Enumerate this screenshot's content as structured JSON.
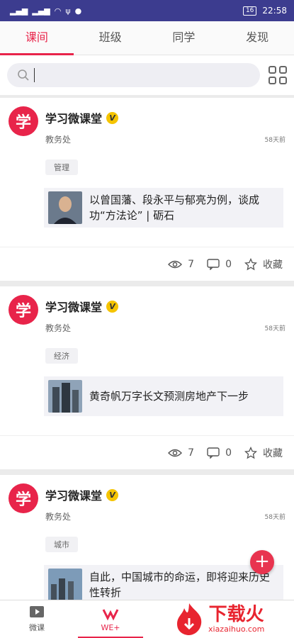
{
  "status_bar": {
    "time": "22:58",
    "battery": "16"
  },
  "tabs": [
    {
      "label": "课间",
      "active": true
    },
    {
      "label": "班级",
      "active": false
    },
    {
      "label": "同学",
      "active": false
    },
    {
      "label": "发现",
      "active": false
    }
  ],
  "search": {
    "placeholder": ""
  },
  "posts": [
    {
      "author": "学习微课堂",
      "badge": "V",
      "dept": "教务处",
      "time": "58天前",
      "tag": "管理",
      "title": "以曾国藩、段永平与郁亮为例，谈成功“方法论” | 砺石",
      "views": "7",
      "comments": "0",
      "fav_label": "收藏"
    },
    {
      "author": "学习微课堂",
      "badge": "V",
      "dept": "教务处",
      "time": "58天前",
      "tag": "经济",
      "title": "黄奇帆万字长文预测房地产下一步",
      "views": "7",
      "comments": "0",
      "fav_label": "收藏"
    },
    {
      "author": "学习微课堂",
      "badge": "V",
      "dept": "教务处",
      "time": "58天前",
      "tag": "城市",
      "title": "自此，中国城市的命运，即将迎来历史性转折",
      "views": "",
      "comments": "",
      "fav_label": ""
    }
  ],
  "fab": {
    "label": "+"
  },
  "bottom_nav": [
    {
      "label": "微课",
      "active": false
    },
    {
      "label": "WE+",
      "active": true
    }
  ],
  "watermark": {
    "cn": "下载火",
    "en": "xiazaihuo.com"
  },
  "colors": {
    "accent": "#e8244a",
    "status_bar": "#3c3c8f",
    "badge": "#f5c400"
  }
}
